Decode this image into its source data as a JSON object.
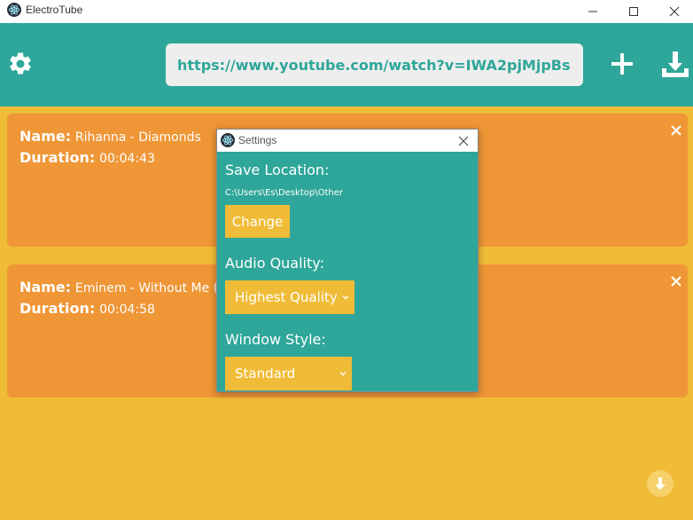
{
  "window": {
    "title": "ElectroTube",
    "icon": "electron-atom-icon",
    "controls": [
      "minimize",
      "maximize",
      "close"
    ]
  },
  "header": {
    "settings_icon": "gear-icon",
    "url_value": "https://www.youtube.com/watch?v=IWA2pjMjpBs",
    "add_icon": "plus-icon",
    "download_icon": "download-icon"
  },
  "queue": [
    {
      "name_label": "Name:",
      "name": "Rihanna - Diamonds",
      "duration_label": "Duration:",
      "duration": "00:04:43"
    },
    {
      "name_label": "Name:",
      "name": "Eminem - Without Me (",
      "duration_label": "Duration:",
      "duration": "00:04:58"
    }
  ],
  "settings_dialog": {
    "title": "Settings",
    "save_location_label": "Save Location:",
    "save_path": "C:\\Users\\Es\\Desktop\\Other",
    "change_button": "Change",
    "audio_quality_label": "Audio Quality:",
    "audio_quality_value": "Highest Quality",
    "window_style_label": "Window Style:",
    "window_style_value": "Standard"
  },
  "colors": {
    "teal": "#2ea699",
    "yellow": "#f0bc37",
    "orange": "#ef9636",
    "url_bg": "#eeeeee"
  }
}
